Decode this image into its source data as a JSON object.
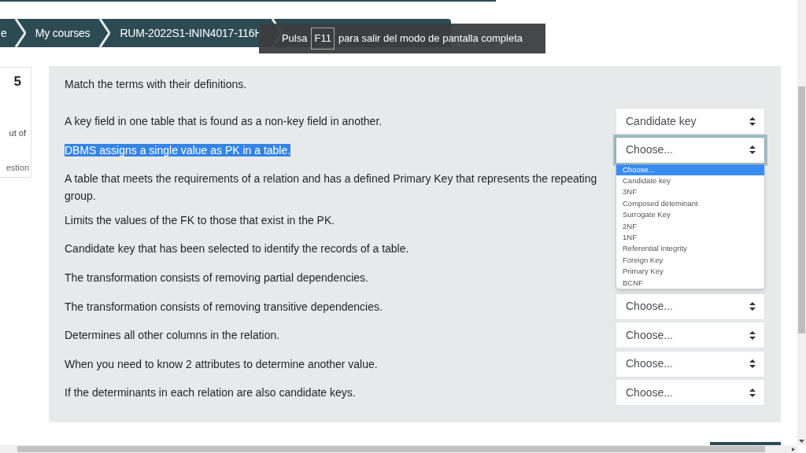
{
  "breadcrumb": [
    {
      "label": "e"
    },
    {
      "label": "My courses"
    },
    {
      "label": "RUM-2022S1-ININ4017-116H"
    }
  ],
  "fullscreen_notice": {
    "before": "Pulsa",
    "key": "F11",
    "after": "para salir del modo de pantalla completa"
  },
  "side_card": {
    "number": "5",
    "line_1": "ut of",
    "line_2": "estion"
  },
  "instruction": "Match the terms with their definitions.",
  "questions": [
    {
      "text": "A key field in one table that is found as a non-key field in another.",
      "highlighted": false,
      "answer": "Candidate key",
      "open": false
    },
    {
      "text": "DBMS assigns a single value as PK in a table.",
      "highlighted": true,
      "answer": "Choose...",
      "open": true
    },
    {
      "text": "A table that meets the requirements of a relation and has a defined Primary Key that represents the repeating group.",
      "highlighted": false
    },
    {
      "text": "Limits the values of the FK to those that exist in the PK.",
      "highlighted": false
    },
    {
      "text": "Candidate key that has been selected to identify the records of a table.",
      "highlighted": false
    },
    {
      "text": "The transformation consists of removing partial dependencies.",
      "highlighted": false
    },
    {
      "text": "The transformation consists of removing transitive dependencies.",
      "highlighted": false,
      "answer": "Choose...",
      "open": false
    },
    {
      "text": "Determines all other columns in the relation.",
      "highlighted": false,
      "answer": "Choose...",
      "open": false
    },
    {
      "text": "When you need to know 2 attributes to determine another value.",
      "highlighted": false,
      "answer": "Choose...",
      "open": false
    },
    {
      "text": "If the determinants in each relation are also candidate keys.",
      "highlighted": false,
      "answer": "Choose...",
      "open": false
    }
  ],
  "dropdown_options": [
    {
      "label": "Choose...",
      "selected": true
    },
    {
      "label": "Candidate key",
      "selected": false
    },
    {
      "label": "3NF",
      "selected": false
    },
    {
      "label": "Composed deteminant",
      "selected": false
    },
    {
      "label": "Surrogate Key",
      "selected": false
    },
    {
      "label": "2NF",
      "selected": false
    },
    {
      "label": "1NF",
      "selected": false
    },
    {
      "label": "Referential integrity",
      "selected": false
    },
    {
      "label": "Foreign Key",
      "selected": false
    },
    {
      "label": "Primary Key",
      "selected": false
    },
    {
      "label": "BCNF",
      "selected": false
    }
  ]
}
